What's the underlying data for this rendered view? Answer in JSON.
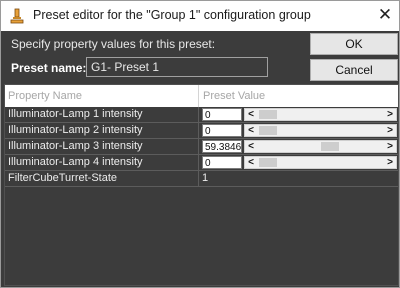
{
  "window": {
    "title": "Preset editor for the \"Group 1\" configuration group",
    "close_glyph": "✕"
  },
  "form": {
    "instruction": "Specify property values for this preset:",
    "preset_name_label": "Preset name:",
    "preset_name_value": "G1- Preset 1"
  },
  "buttons": {
    "ok": "OK",
    "cancel": "Cancel"
  },
  "table": {
    "columns": [
      "Property Name",
      "Preset Value"
    ],
    "rows": [
      {
        "name": "Illuminator-Lamp 1 intensity",
        "value": "0",
        "slider_fraction": 0.0
      },
      {
        "name": "Illuminator-Lamp 2 intensity",
        "value": "0",
        "slider_fraction": 0.0
      },
      {
        "name": "Illuminator-Lamp 3 intensity",
        "value": "59.38461",
        "slider_fraction": 0.59
      },
      {
        "name": "Illuminator-Lamp 4 intensity",
        "value": "0",
        "slider_fraction": 0.0
      },
      {
        "name": "FilterCubeTurret-State",
        "value": "1"
      }
    ]
  },
  "icons": {
    "app": "microscope-app-icon",
    "close": "close-icon",
    "slider_left": "arrow-left-icon",
    "slider_right": "arrow-right-icon"
  },
  "colors": {
    "dialog_bg": "#3c3c3c",
    "titlebar_bg": "#ffffff",
    "button_bg": "#e6e6e6",
    "accent_icon": "#e8a13a"
  }
}
